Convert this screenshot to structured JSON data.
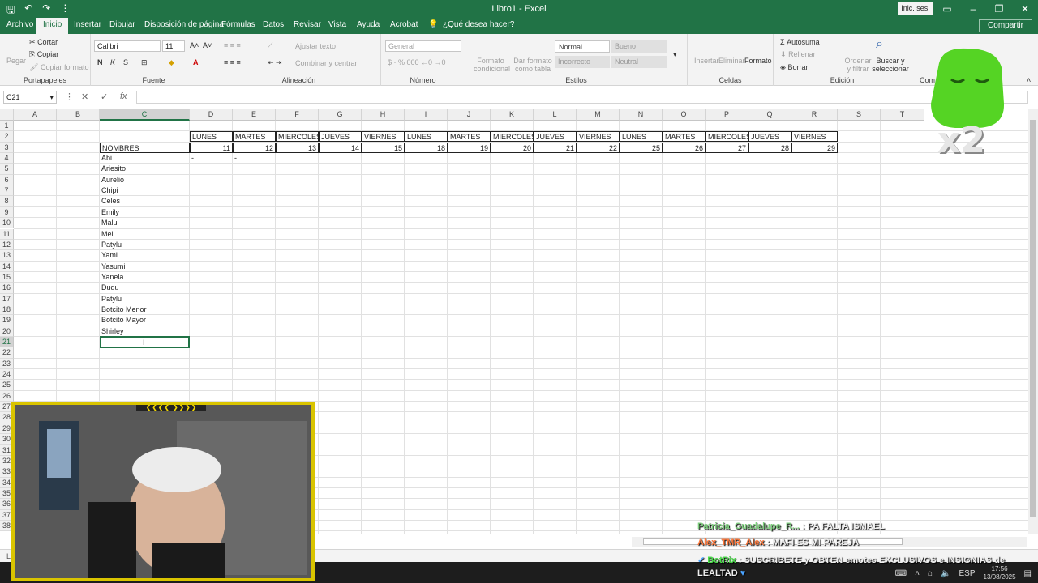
{
  "window": {
    "title": "Libro1 - Excel",
    "sign_in": "Inic. ses."
  },
  "tabs": [
    "Archivo",
    "Inicio",
    "Insertar",
    "Dibujar",
    "Disposición de página",
    "Fórmulas",
    "Datos",
    "Revisar",
    "Vista",
    "Ayuda",
    "Acrobat"
  ],
  "tell_me": "¿Qué desea hacer?",
  "share": "Compartir",
  "ribbon": {
    "clipboard": {
      "paste": "Pegar",
      "cut": "Cortar",
      "copy": "Copiar",
      "format_painter": "Copiar formato",
      "label": "Portapapeles"
    },
    "font": {
      "name": "Calibri",
      "size": "11",
      "bold": "N",
      "italic": "K",
      "underline": "S",
      "label": "Fuente"
    },
    "alignment": {
      "wrap": "Ajustar texto",
      "merge": "Combinar y centrar",
      "label": "Alineación"
    },
    "number": {
      "format": "General",
      "label": "Número"
    },
    "styles": {
      "conditional": "Formato condicional",
      "as_table": "Dar formato como tabla",
      "normal": "Normal",
      "good": "Bueno",
      "bad": "Incorrecto",
      "neutral": "Neutral",
      "label": "Estilos"
    },
    "cells": {
      "insert": "Insertar",
      "delete": "Eliminar",
      "format": "Formato",
      "label": "Celdas"
    },
    "editing": {
      "autosum": "Autosuma",
      "fill": "Rellenar",
      "clear": "Borrar",
      "sort": "Ordenar y filtrar",
      "find": "Buscar y seleccionar",
      "label": "Edición"
    },
    "extra": {
      "label": "Com"
    }
  },
  "formula_bar": {
    "name_box": "C21",
    "cancel": "✕",
    "enter": "✓",
    "fx": "fx",
    "value": ""
  },
  "columns": [
    "A",
    "B",
    "C",
    "D",
    "E",
    "F",
    "G",
    "H",
    "I",
    "J",
    "K",
    "L",
    "M",
    "N",
    "O",
    "P",
    "Q",
    "R",
    "S",
    "T"
  ],
  "rows": [
    "1",
    "2",
    "3",
    "4",
    "5",
    "6",
    "7",
    "8",
    "9",
    "10",
    "11",
    "12",
    "13",
    "14",
    "15",
    "16",
    "17",
    "18",
    "19",
    "20",
    "21",
    "22",
    "23",
    "24",
    "25",
    "26",
    "27",
    "28",
    "29",
    "30",
    "31",
    "32",
    "33",
    "34",
    "35",
    "36",
    "37",
    "38"
  ],
  "sheet": {
    "days": [
      "LUNES",
      "MARTES",
      "MIERCOLES",
      "JUEVES",
      "VIERNES",
      "LUNES",
      "MARTES",
      "MIERCOLES",
      "JUEVES",
      "VIERNES",
      "LUNES",
      "MARTES",
      "MIERCOLES",
      "JUEVES",
      "VIERNES"
    ],
    "header_label": "NOMBRES",
    "dates": [
      "11",
      "12",
      "13",
      "14",
      "15",
      "18",
      "19",
      "20",
      "21",
      "22",
      "25",
      "26",
      "27",
      "28",
      "29"
    ],
    "names": [
      "Abi",
      "Ariesito",
      "Aurelio",
      "Chipi",
      "Celes",
      "Emily",
      "Malu",
      "Meli",
      "Patylu",
      "Yami",
      "Yasumi",
      "Yanela",
      "Dudu",
      "Patylu",
      "Botcito Menor",
      "Botcito Mayor",
      "Shirley"
    ],
    "abi_marks": [
      "-",
      "-"
    ]
  },
  "status": {
    "left": "Listo"
  },
  "stream": {
    "chat": [
      {
        "user": "Patricia_Guadalupe_R...",
        "message": ": PA FALTA ISMAEL"
      },
      {
        "user": "Alex_TMR_Alex",
        "message": ": MAFI ES MI PAREJA"
      }
    ],
    "bot": {
      "user": "BotRix",
      "message": ": SUSCRIBETE y OBTEN emotes EXCLUSIVOS e INSIGNIAS de",
      "message2": "LEALTAD"
    },
    "emote_multiplier": "x2"
  },
  "taskbar": {
    "lang": "ESP",
    "time": "17:56",
    "date": "13/08/2025"
  },
  "colors": {
    "accent": "#217346",
    "selection": "#217346"
  }
}
